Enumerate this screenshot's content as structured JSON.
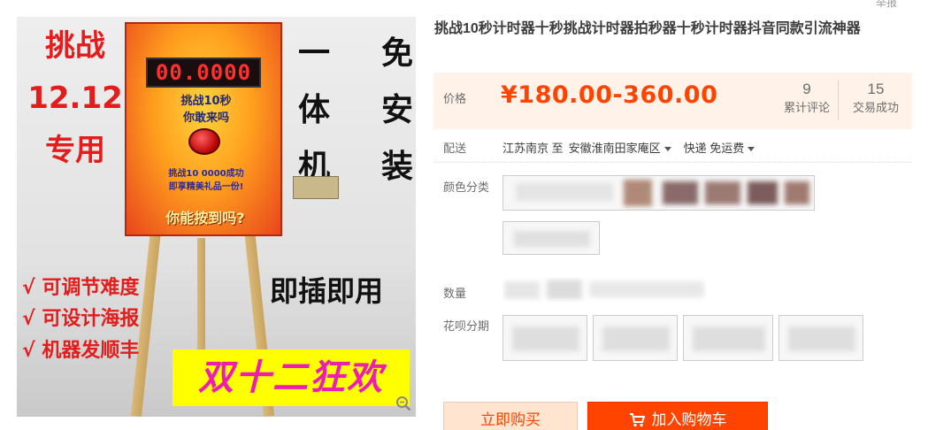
{
  "product_image": {
    "left_overlay": [
      "挑战",
      "12.12",
      "专用"
    ],
    "right_overlay_cols": [
      [
        "一",
        "免"
      ],
      [
        "体",
        "安"
      ],
      [
        "机",
        "装"
      ]
    ],
    "board": {
      "timer": "00.0000",
      "title_line1": "挑战10秒",
      "title_line2": "你敢来吗",
      "rule_line1": "挑战10 0000成功",
      "rule_line2": "即享精美礼品一份!",
      "slogan": "你能按到吗?"
    },
    "checklist": [
      "√ 可调节难度",
      "√ 可设计海报",
      "√ 机器发顺丰"
    ],
    "plug_text": "即插即用",
    "promo_banner": "双十二狂欢"
  },
  "header": {
    "top_cut_text": "举报",
    "title": "挑战10秒计时器十秒挑战计时器拍秒器十秒计时器抖音同款引流神器"
  },
  "price": {
    "label": "价格",
    "value": "¥180.00-360.00",
    "reviews": {
      "count": "9",
      "label": "累计评论"
    },
    "sales": {
      "count": "15",
      "label": "交易成功"
    }
  },
  "shipping": {
    "label": "配送",
    "from": "江苏南京 至",
    "to": "安徽淮南田家庵区",
    "method": "快递 免运费"
  },
  "options": {
    "color_label": "颜色分类",
    "quantity_label": "数量",
    "installment_label": "花呗分期"
  },
  "actions": {
    "buy_now": "立即购买",
    "add_to_cart": "加入购物车"
  },
  "colors": {
    "price": "#ff4400",
    "price_bg": "#fff2e8",
    "cart_button": "#ff4400",
    "buy_button_bg": "#ffe4d0"
  }
}
